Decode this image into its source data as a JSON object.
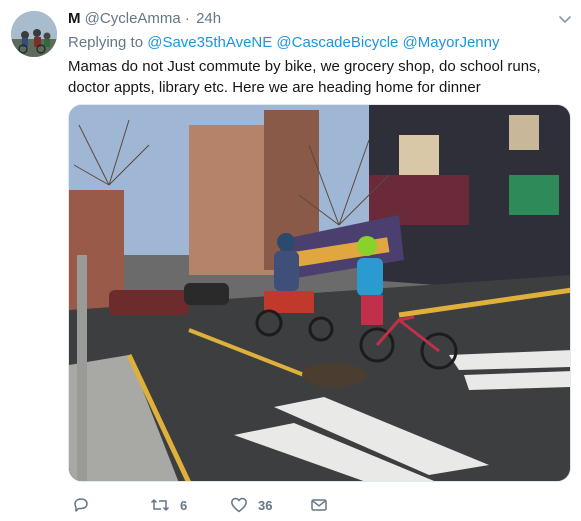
{
  "tweet": {
    "author_name": "M",
    "author_handle": "@CycleAmma",
    "separator": "·",
    "time": "24h",
    "replying_prefix": "Replying to",
    "mentions": [
      "@Save35thAveNE",
      "@CascadeBicycle",
      "@MayorJenny"
    ],
    "text": "Mamas do not Just commute by bike, we grocery shop, do school runs, doctor appts, library etc. Here we are heading home for dinner",
    "retweet_count": "6",
    "like_count": "36",
    "icons": {
      "reply": "reply-icon",
      "retweet": "retweet-icon",
      "like": "heart-icon",
      "message": "envelope-icon",
      "more": "chevron-down-icon"
    },
    "colors": {
      "link": "#1b95e0",
      "secondary_text": "#657786",
      "primary_text": "#14171a"
    }
  }
}
